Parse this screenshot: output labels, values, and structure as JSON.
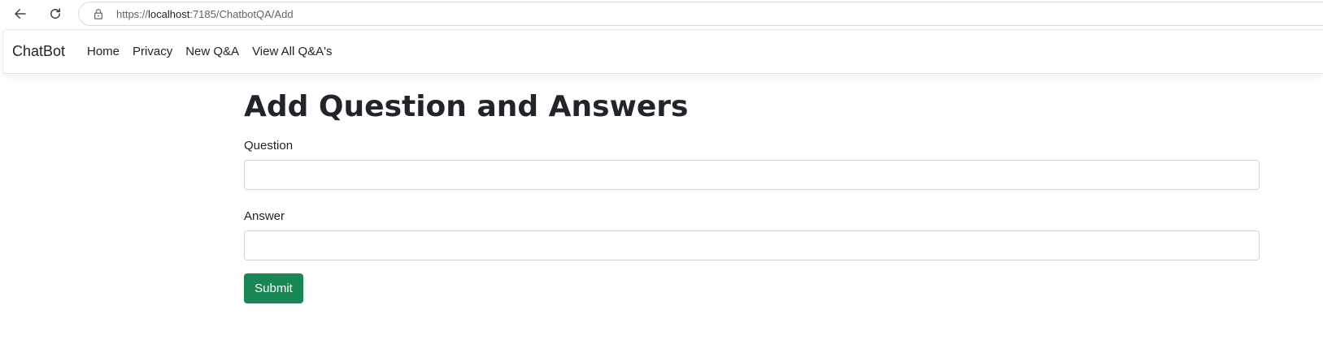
{
  "browser": {
    "url_prefix": "https://",
    "url_host": "localhost",
    "url_rest": ":7185/ChatbotQA/Add"
  },
  "navbar": {
    "brand": "ChatBot",
    "links": [
      {
        "label": "Home"
      },
      {
        "label": "Privacy"
      },
      {
        "label": "New Q&A"
      },
      {
        "label": "View All Q&A's"
      }
    ]
  },
  "form": {
    "title": "Add Question and Answers",
    "question_label": "Question",
    "question_value": "",
    "answer_label": "Answer",
    "answer_value": "",
    "submit_label": "Submit"
  },
  "colors": {
    "submit": "#198754",
    "text": "#212529"
  }
}
